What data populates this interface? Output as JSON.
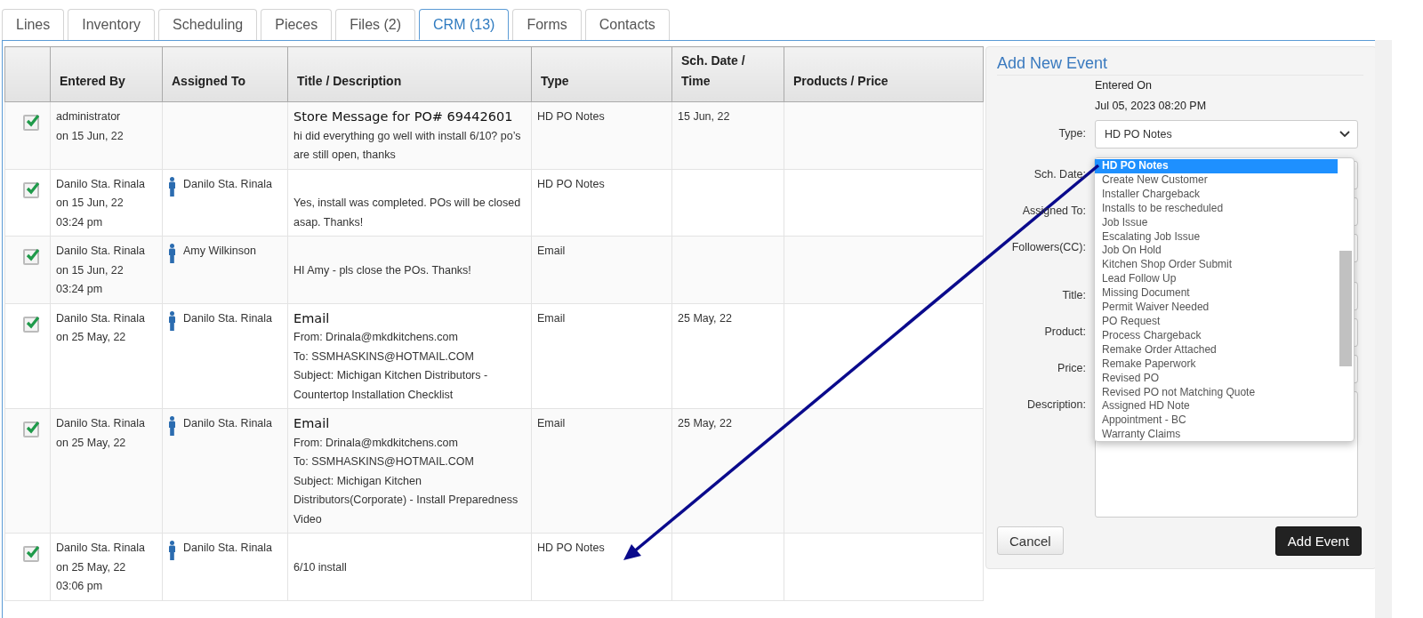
{
  "tabs": [
    {
      "label": "Lines",
      "selected": false
    },
    {
      "label": "Inventory",
      "selected": false
    },
    {
      "label": "Scheduling",
      "selected": false
    },
    {
      "label": "Pieces",
      "selected": false
    },
    {
      "label": "Files (2)",
      "selected": false
    },
    {
      "label": "CRM (13)",
      "selected": true
    },
    {
      "label": "Forms",
      "selected": false
    },
    {
      "label": "Contacts",
      "selected": false
    }
  ],
  "table": {
    "columns": [
      "Entered By",
      "Assigned To",
      "Title / Description",
      "Type",
      "Sch. Date / Time",
      "Products / Price"
    ],
    "rows": [
      {
        "checked": true,
        "entered_by": [
          "administrator",
          "on 15 Jun, 22"
        ],
        "title": "Store Message for PO# 69442601",
        "description": [
          "hi did everything go well with install 6/10? po’s are still open, thanks"
        ],
        "type": "HD PO Notes",
        "sch_date": "15 Jun, 22"
      },
      {
        "checked": true,
        "entered_by": [
          "Danilo Sta. Rinala",
          "on 15 Jun, 22",
          "03:24 pm"
        ],
        "assigned_to": "Danilo Sta. Rinala",
        "description": [
          "Yes, install was completed. POs will be closed asap. Thanks!"
        ],
        "type": "HD PO Notes"
      },
      {
        "checked": true,
        "entered_by": [
          "Danilo Sta. Rinala",
          "on 15 Jun, 22",
          "03:24 pm"
        ],
        "assigned_to": "Amy Wilkinson",
        "description": [
          "HI Amy - pls close the POs. Thanks!"
        ],
        "type": "Email"
      },
      {
        "checked": true,
        "entered_by": [
          "Danilo Sta. Rinala",
          "on 25 May, 22"
        ],
        "assigned_to": "Danilo Sta. Rinala",
        "title": "Email",
        "description": [
          "From: Drinala@mkdkitchens.com",
          "To: SSMHASKINS@HOTMAIL.COM",
          "Subject: Michigan Kitchen Distributors - Countertop Installation Checklist"
        ],
        "type": "Email",
        "sch_date": "25 May, 22"
      },
      {
        "checked": true,
        "entered_by": [
          "Danilo Sta. Rinala",
          "on 25 May, 22"
        ],
        "assigned_to": "Danilo Sta. Rinala",
        "title": "Email",
        "description": [
          "From: Drinala@mkdkitchens.com",
          "To: SSMHASKINS@HOTMAIL.COM",
          "Subject: Michigan Kitchen Distributors(Corporate) - Install Preparedness Video"
        ],
        "type": "Email",
        "sch_date": "25 May, 22"
      },
      {
        "checked": true,
        "entered_by": [
          "Danilo Sta. Rinala",
          "on 25 May, 22",
          "03:06 pm"
        ],
        "assigned_to": "Danilo Sta. Rinala",
        "description": [
          "6/10 install"
        ],
        "type": "HD PO Notes"
      }
    ]
  },
  "panel": {
    "title": "Add New Event",
    "entered_on_label": "Entered On",
    "entered_on": "Jul 05, 2023 08:20 PM",
    "type_label": "Type:",
    "type_value": "HD PO Notes",
    "type_options": [
      {
        "label": "HD PO Notes",
        "selected": true
      },
      {
        "label": "Create New Customer",
        "selected": false
      },
      {
        "label": "Installer Chargeback",
        "selected": false
      },
      {
        "label": "Installs to be rescheduled",
        "selected": false
      },
      {
        "label": "Job Issue",
        "selected": false
      },
      {
        "label": "Escalating Job Issue",
        "selected": false
      },
      {
        "label": "Job On Hold",
        "selected": false
      },
      {
        "label": "Kitchen Shop Order Submit",
        "selected": false
      },
      {
        "label": "Lead Follow Up",
        "selected": false
      },
      {
        "label": "Missing Document",
        "selected": false
      },
      {
        "label": "Permit Waiver Needed",
        "selected": false
      },
      {
        "label": "PO Request",
        "selected": false
      },
      {
        "label": "Process Chargeback",
        "selected": false
      },
      {
        "label": "Remake Order Attached",
        "selected": false
      },
      {
        "label": "Remake Paperwork",
        "selected": false
      },
      {
        "label": "Revised PO",
        "selected": false
      },
      {
        "label": "Revised PO not Matching Quote",
        "selected": false
      },
      {
        "label": "Assigned HD Note",
        "selected": false
      },
      {
        "label": "Appointment - BC",
        "selected": false
      },
      {
        "label": "Warranty Claims",
        "selected": false
      }
    ],
    "fields": [
      "Sch. Date:",
      "Assigned To:",
      "Followers(CC):",
      "Title:",
      "Product:",
      "Price:"
    ],
    "description_label": "Description:",
    "cancel": "Cancel",
    "submit": "Add Event"
  }
}
